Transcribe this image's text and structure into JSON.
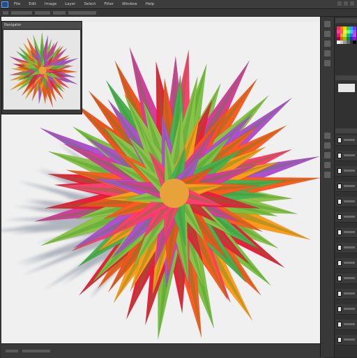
{
  "app": {
    "logo_icon": "photoshop-logo-icon"
  },
  "menu": {
    "items": [
      "File",
      "Edit",
      "Image",
      "Layer",
      "Select",
      "Filter",
      "Window",
      "Help"
    ]
  },
  "navigator": {
    "title": "Navigator"
  },
  "colors": {
    "canvas_bg": "#f0f0f0",
    "chrome_dark": "#2b2b2b",
    "panel": "#313131"
  },
  "right_panel": {
    "icons": [
      "history-icon",
      "brush-icon",
      "character-icon",
      "paragraph-icon",
      "swatches-icon",
      "adjustments-icon",
      "styles-icon",
      "layers-icon",
      "channels-icon",
      "paths-icon"
    ],
    "swatches": [
      "#ff2d55",
      "#ff7a1a",
      "#ffd400",
      "#3ad13a",
      "#1ea7ff",
      "#7a3cff",
      "#ff3da6",
      "#ff5e3a",
      "#ffe84a",
      "#6cff6c",
      "#38c7ff",
      "#a050ff",
      "#e0197d",
      "#ff9a2e",
      "#c8e83a",
      "#1fb86a",
      "#2a6cff",
      "#d040ff",
      "#b00048",
      "#d46a00",
      "#9ab800",
      "#0e8a4a",
      "#1a3cb0",
      "#8a1fd0",
      "#ffffff",
      "#cccccc",
      "#999999",
      "#666666",
      "#333333",
      "#000000"
    ]
  }
}
